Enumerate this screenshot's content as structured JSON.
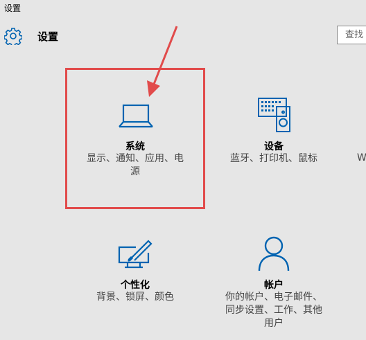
{
  "window": {
    "title": "设置"
  },
  "header": {
    "title": "设置",
    "gear_icon": "gear-icon"
  },
  "search": {
    "placeholder": "查找"
  },
  "tiles": [
    {
      "name": "系统",
      "desc_line1": "显示、通知、应用、电",
      "desc_line2": "源",
      "icon": "laptop-icon"
    },
    {
      "name": "设备",
      "desc_line1": "蓝牙、打印机、鼠标",
      "icon": "devices-icon"
    },
    {
      "name": "个性化",
      "desc_line1": "背景、锁屏、颜色",
      "icon": "personalization-icon"
    },
    {
      "name": "帐户",
      "desc_line1": "你的帐户、电子邮件、",
      "desc_line2": "同步设置、工作、其他",
      "desc_line3": "用户",
      "icon": "account-icon"
    }
  ],
  "edge": {
    "letter": "W"
  },
  "colors": {
    "accent": "#0063b1",
    "annotation": "#e14b4b",
    "background": "#e6e6e6"
  }
}
